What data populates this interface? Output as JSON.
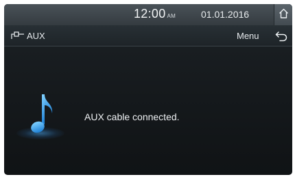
{
  "status_bar": {
    "time": "12:00",
    "ampm": "AM",
    "date": "01.01.2016",
    "home_icon": "home-icon"
  },
  "header": {
    "source_icon": "aux-plug-icon",
    "source_label": "AUX",
    "menu_label": "Menu",
    "back_icon": "back-arrow-icon"
  },
  "content": {
    "icon": "music-note-icon",
    "message": "AUX cable connected."
  }
}
